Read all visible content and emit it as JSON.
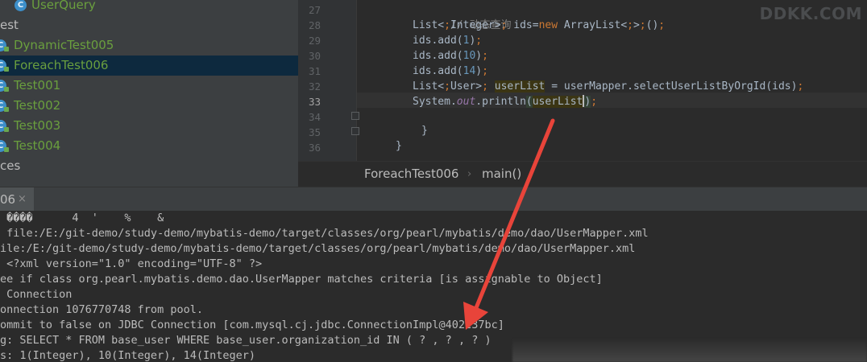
{
  "project_tree": {
    "items": [
      {
        "label": "UserQuery",
        "kind": "class",
        "color": "green",
        "selected": false
      },
      {
        "label": "est",
        "kind": "folder",
        "color": "gray",
        "selected": false
      },
      {
        "label": "DynamicTest005",
        "kind": "test-class",
        "color": "green",
        "selected": false
      },
      {
        "label": "ForeachTest006",
        "kind": "test-class",
        "color": "green",
        "selected": true
      },
      {
        "label": "Test001",
        "kind": "test-class",
        "color": "green",
        "selected": false
      },
      {
        "label": "Test002",
        "kind": "test-class",
        "color": "green",
        "selected": false
      },
      {
        "label": "Test003",
        "kind": "test-class",
        "color": "green",
        "selected": false
      },
      {
        "label": "Test004",
        "kind": "test-class",
        "color": "green",
        "selected": false
      },
      {
        "label": "ces",
        "kind": "folder",
        "color": "gray",
        "selected": false
      }
    ],
    "class_icon_letter": "C"
  },
  "editor": {
    "watermark": "DDKK.COM",
    "current_line": 33,
    "lines": [
      {
        "num": "27",
        "text": "// 动态查询"
      },
      {
        "num": "28",
        "text": "List<Integer> ids=new ArrayList<>();"
      },
      {
        "num": "29",
        "text": "ids.add(1);"
      },
      {
        "num": "30",
        "text": "ids.add(10);"
      },
      {
        "num": "31",
        "text": "ids.add(14);"
      },
      {
        "num": "32",
        "text": "List<User> userList = userMapper.selectUserListByOrgId(ids);"
      },
      {
        "num": "33",
        "text": "System.out.println(userList);"
      },
      {
        "num": "34",
        "text": "}"
      },
      {
        "num": "35",
        "text": "}"
      },
      {
        "num": "36",
        "text": ""
      }
    ]
  },
  "breadcrumb": {
    "items": [
      "ForeachTest006",
      "main()"
    ],
    "separator": "›"
  },
  "run_panel": {
    "tab_label": "06",
    "close_glyph": "×",
    "console_lines": [
      " ����      4  '    %    &",
      " file:/E:/git-demo/study-demo/mybatis-demo/target/classes/org/pearl/mybatis/demo/dao/UserMapper.xml",
      "ile:/E:/git-demo/study-demo/mybatis-demo/target/classes/org/pearl/mybatis/demo/dao/UserMapper.xml",
      " <?xml version=\"1.0\" encoding=\"UTF-8\" ?>",
      "ee if class org.pearl.mybatis.demo.dao.UserMapper matches criteria [is assignable to Object]",
      " Connection",
      "onnection 1076770748 from pool.",
      "ommit to false on JDBC Connection [com.mysql.cj.jdbc.ConnectionImpl@402e37bc]",
      "g: SELECT * FROM base_user WHERE base_user.organization_id IN ( ? , ? , ? )",
      "s: 1(Integer), 10(Integer), 14(Integer)"
    ]
  },
  "colors": {
    "annotation_arrow": "#e8443a",
    "selection": "#0d293e",
    "test_class_label": "#6a9f3e"
  }
}
